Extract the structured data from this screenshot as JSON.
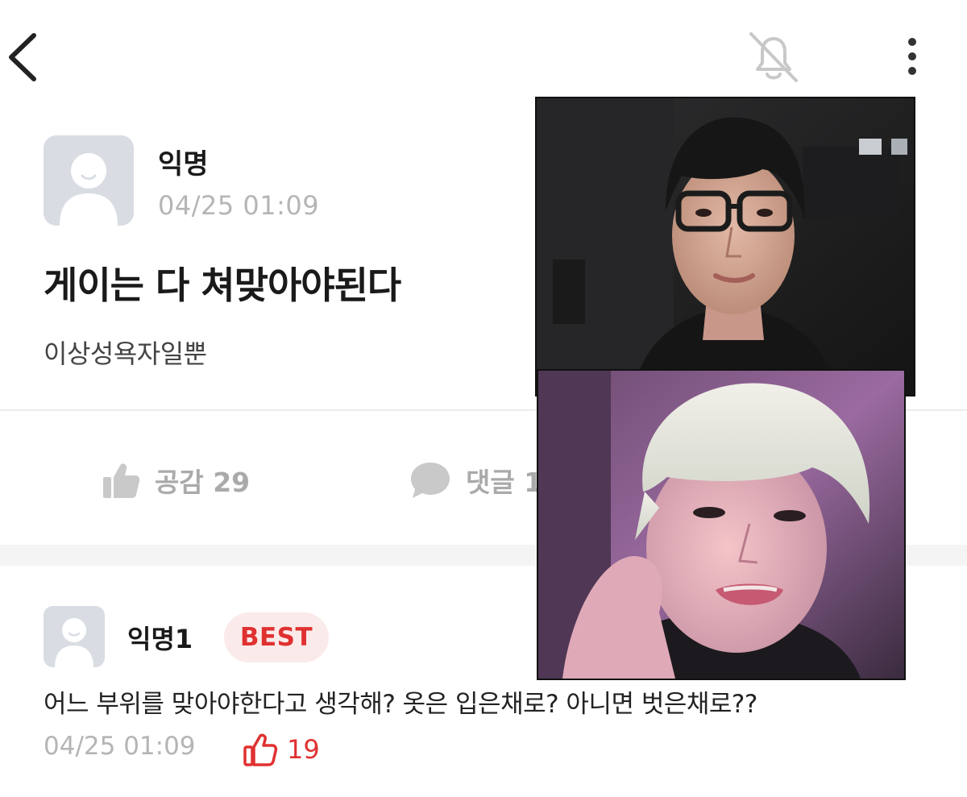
{
  "header": {
    "back_icon": "chevron-left-icon",
    "notification_icon": "bell-off-icon",
    "more_icon": "more-vertical-icon"
  },
  "post": {
    "author": "익명",
    "time": "04/25 01:09",
    "title": "게이는 다 쳐맞아야된다",
    "body": "이상성욕자일뿐",
    "actions": {
      "like_label": "공감 29",
      "comment_label": "댓글 1"
    }
  },
  "comment": {
    "author": "익명1",
    "badge": "BEST",
    "body": "어느 부위를 맞아야한다고 생각해? 옷은 입은채로? 아니면 벗은채로??",
    "time": "04/25 01:09",
    "like_count": "19"
  },
  "colors": {
    "accent_red": "#e03131",
    "muted_gray": "#b5b5b5",
    "badge_bg": "#fbeaea"
  }
}
